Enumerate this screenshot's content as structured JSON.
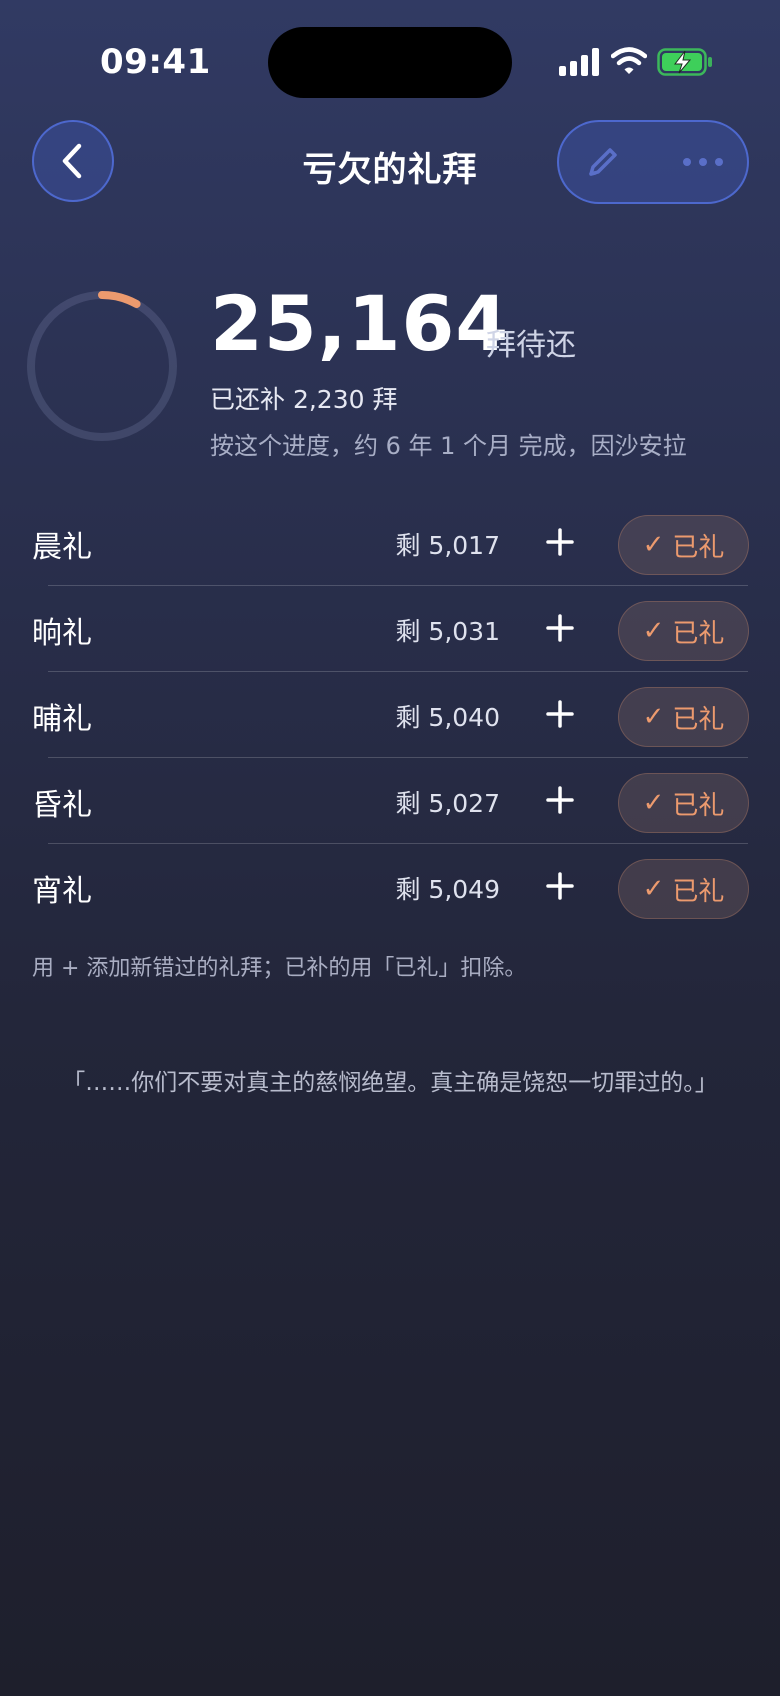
{
  "status": {
    "time": "09:41"
  },
  "nav": {
    "title": "亏欠的礼拜"
  },
  "summary": {
    "pending_count": "25,164",
    "pending_unit": "拜待还",
    "repaid_text": "已还补 2,230 拜",
    "projection_text": "按这个进度，约 6 年 1 个月 完成，因沙安拉",
    "progress_fraction": 0.081,
    "accent_color": "#ec9a6e"
  },
  "prayers": [
    {
      "name": "晨礼",
      "remaining": "剩 5,017",
      "done_label": "已礼"
    },
    {
      "name": "晌礼",
      "remaining": "剩 5,031",
      "done_label": "已礼"
    },
    {
      "name": "晡礼",
      "remaining": "剩 5,040",
      "done_label": "已礼"
    },
    {
      "name": "昏礼",
      "remaining": "剩 5,027",
      "done_label": "已礼"
    },
    {
      "name": "宵礼",
      "remaining": "剩 5,049",
      "done_label": "已礼"
    }
  ],
  "hint": "用 + 添加新错过的礼拜；已补的用「已礼」扣除。",
  "quote": "「……你们不要对真主的慈悯绝望。真主确是饶恕一切罪过的。」"
}
